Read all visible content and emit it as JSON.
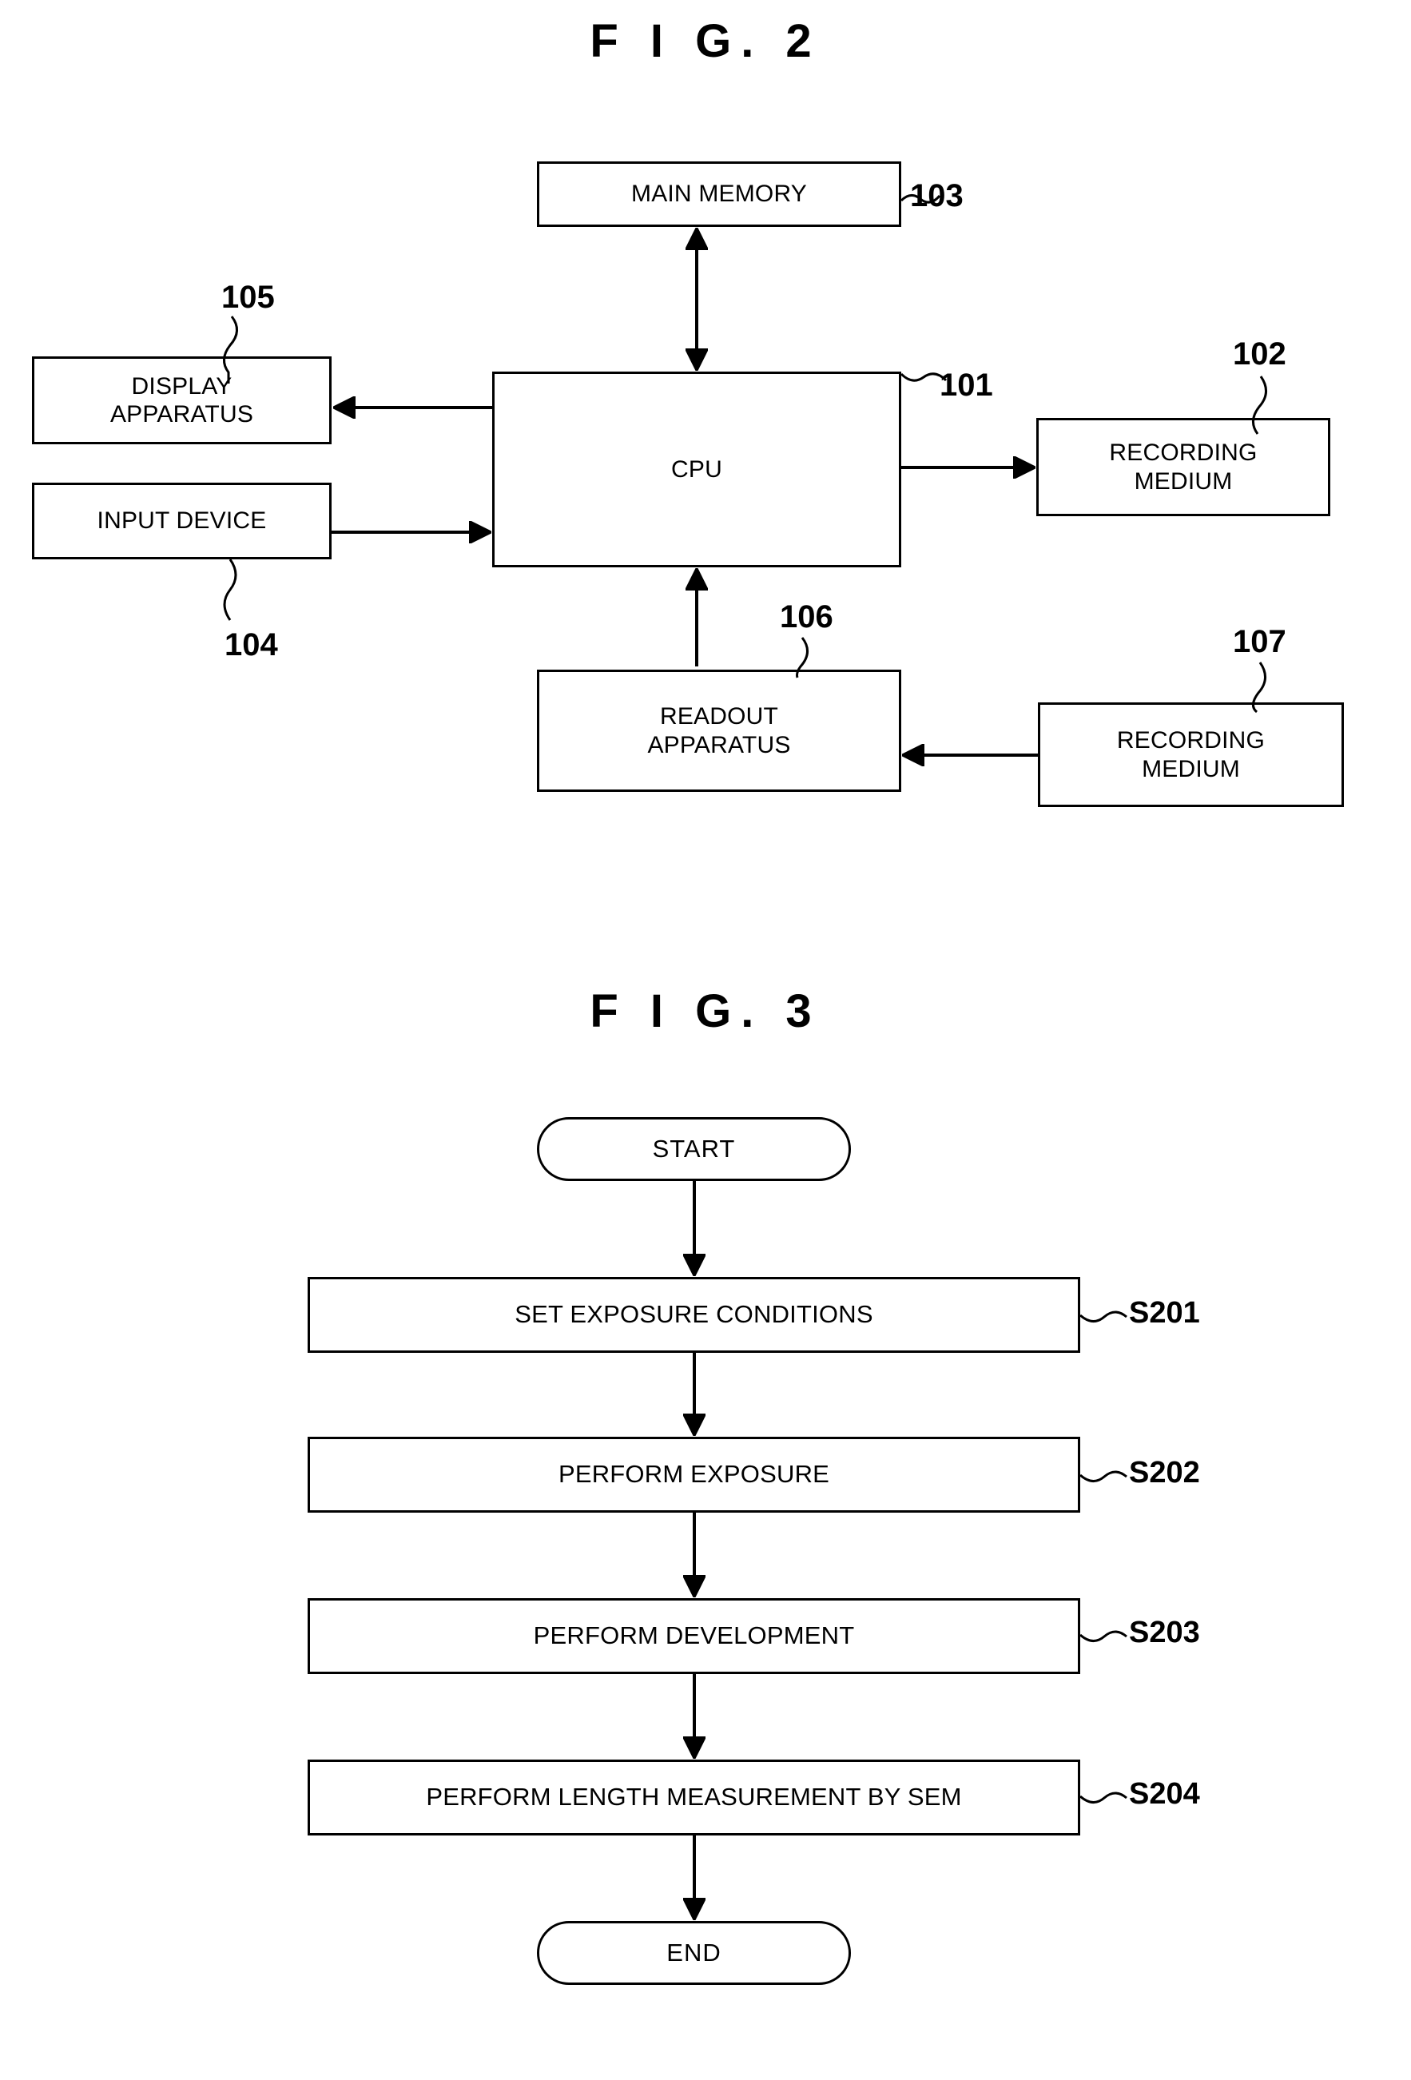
{
  "figures": [
    {
      "title": "F I G. 2",
      "type": "block-diagram",
      "blocks": [
        {
          "id": "main-memory",
          "label": "MAIN MEMORY",
          "ref": "103"
        },
        {
          "id": "cpu",
          "label": "CPU",
          "ref": "101"
        },
        {
          "id": "display",
          "label": "DISPLAY\nAPPARATUS",
          "ref": "105"
        },
        {
          "id": "input-device",
          "label": "INPUT DEVICE",
          "ref": "104"
        },
        {
          "id": "recording-medium-102",
          "label": "RECORDING\nMEDIUM",
          "ref": "102"
        },
        {
          "id": "readout",
          "label": "READOUT\nAPPARATUS",
          "ref": "106"
        },
        {
          "id": "recording-medium-107",
          "label": "RECORDING\nMEDIUM",
          "ref": "107"
        }
      ],
      "connections": [
        {
          "from": "main-memory",
          "to": "cpu",
          "arrow": "both"
        },
        {
          "from": "cpu",
          "to": "display",
          "arrow": "to"
        },
        {
          "from": "input-device",
          "to": "cpu",
          "arrow": "to"
        },
        {
          "from": "cpu",
          "to": "recording-medium-102",
          "arrow": "to"
        },
        {
          "from": "readout",
          "to": "cpu",
          "arrow": "to"
        },
        {
          "from": "recording-medium-107",
          "to": "readout",
          "arrow": "to"
        }
      ]
    },
    {
      "title": "F I G. 3",
      "type": "flowchart",
      "start_label": "START",
      "end_label": "END",
      "steps": [
        {
          "label": "SET EXPOSURE CONDITIONS",
          "ref": "S201"
        },
        {
          "label": "PERFORM EXPOSURE",
          "ref": "S202"
        },
        {
          "label": "PERFORM DEVELOPMENT",
          "ref": "S203"
        },
        {
          "label": "PERFORM LENGTH MEASUREMENT BY SEM",
          "ref": "S204"
        }
      ]
    }
  ],
  "colors": {
    "stroke": "#000000",
    "background": "#ffffff"
  }
}
